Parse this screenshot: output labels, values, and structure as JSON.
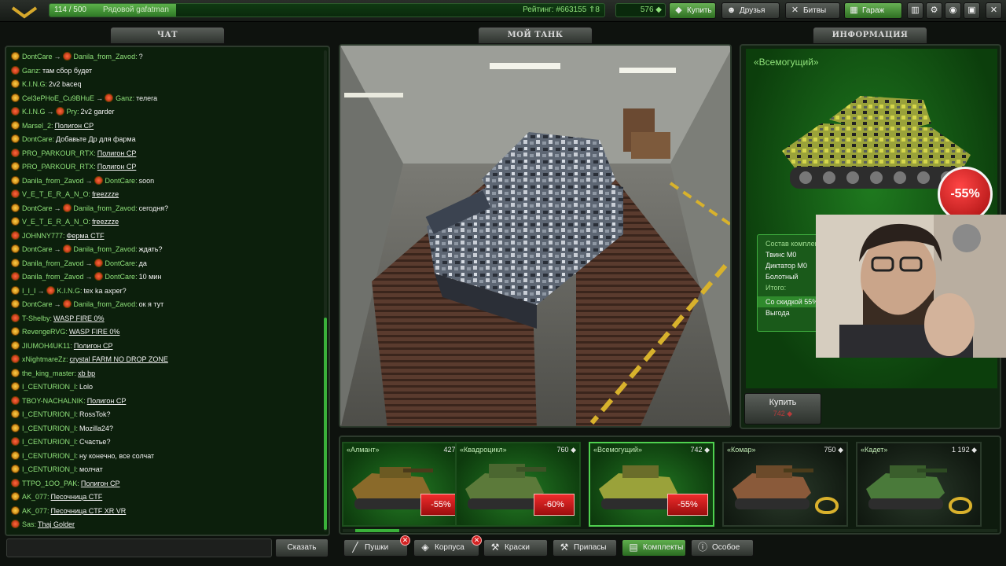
{
  "topbar": {
    "xp": "114 / 500",
    "xp_progress": 0.228,
    "rank_name": "Рядовой gafatman",
    "rating": "Рейтинг: #663155 ⇑8",
    "crystals": "576",
    "buy": "Купить",
    "friends": "Друзья",
    "battles": "Битвы",
    "garage": "Гараж"
  },
  "panels": {
    "chat": "ЧАТ",
    "my_tank": "МОЙ ТАНК",
    "info": "ИНФОРМАЦИЯ"
  },
  "chat": {
    "messages": [
      {
        "from": "DontCare",
        "to": "Danila_from_Zavod",
        "text": "?",
        "link": false
      },
      {
        "from": "Ganz",
        "to": "",
        "text": "там сбор будет",
        "link": false
      },
      {
        "from": "K.I.N.G",
        "to": "",
        "text": "2v2 baceq",
        "link": false
      },
      {
        "from": "Cel3ePHoE_Cu9BHuE",
        "to": "Ganz",
        "text": "телега",
        "link": false
      },
      {
        "from": "K.I.N.G",
        "to": "Pry",
        "text": "2v2 garder",
        "link": false
      },
      {
        "from": "Marsel_2",
        "to": "",
        "text": "Полигон CP",
        "link": true
      },
      {
        "from": "DontCare",
        "to": "",
        "text": "Добавьте Др для фарма",
        "link": false
      },
      {
        "from": "PRO_PARKOUR_RTX",
        "to": "",
        "text": "Полигон CP",
        "link": true
      },
      {
        "from": "PRO_PARKOUR_RTX",
        "to": "",
        "text": "Полигон CP",
        "link": true
      },
      {
        "from": "Danila_from_Zavod",
        "to": "DontCare",
        "text": "soon",
        "link": false
      },
      {
        "from": "V_E_T_E_R_A_N_O",
        "to": "",
        "text": "freezzze",
        "link": true
      },
      {
        "from": "DontCare",
        "to": "Danila_from_Zavod",
        "text": "сегодня?",
        "link": false
      },
      {
        "from": "V_E_T_E_R_A_N_O",
        "to": "",
        "text": "freezzze",
        "link": true
      },
      {
        "from": "JOHNNY777",
        "to": "",
        "text": "Ферма CTF",
        "link": true
      },
      {
        "from": "DontCare",
        "to": "Danila_from_Zavod",
        "text": "ждать?",
        "link": false
      },
      {
        "from": "Danila_from_Zavod",
        "to": "DontCare",
        "text": "да",
        "link": false
      },
      {
        "from": "Danila_from_Zavod",
        "to": "DontCare",
        "text": "10 мин",
        "link": false
      },
      {
        "from": "I_I_I",
        "to": "K.I.N.G",
        "text": "tex ka axper?",
        "link": false
      },
      {
        "from": "DontCare",
        "to": "Danila_from_Zavod",
        "text": "ок я тут",
        "link": false
      },
      {
        "from": "T-Shelby",
        "to": "",
        "text": "WASP FIRE 0%",
        "link": true
      },
      {
        "from": "RevengeRVG",
        "to": "",
        "text": "WASP FIRE 0%",
        "link": true
      },
      {
        "from": "JIUMOH4UK11",
        "to": "",
        "text": "Полигон CP",
        "link": true
      },
      {
        "from": "xNightmareZz",
        "to": "",
        "text": "crystal FARM NO DROP ZONE",
        "link": true
      },
      {
        "from": "the_king_master",
        "to": "",
        "text": "xb bp",
        "link": true
      },
      {
        "from": "I_CENTURION_I",
        "to": "",
        "text": "Lolo",
        "link": false
      },
      {
        "from": "TBOY-NACHALNIK",
        "to": "",
        "text": "Полигон CP",
        "link": true
      },
      {
        "from": "I_CENTURION_I",
        "to": "",
        "text": "RossTok?",
        "link": false
      },
      {
        "from": "I_CENTURION_I",
        "to": "",
        "text": "Mozilla24?",
        "link": false
      },
      {
        "from": "I_CENTURION_I",
        "to": "",
        "text": "Счастье?",
        "link": false
      },
      {
        "from": "I_CENTURION_I",
        "to": "",
        "text": "ну конечно, все солчат",
        "link": false
      },
      {
        "from": "I_CENTURION_I",
        "to": "",
        "text": "молчат",
        "link": false
      },
      {
        "from": "TTPO_1OO_PAK",
        "to": "",
        "text": "Полигон CP",
        "link": true
      },
      {
        "from": "AK_077",
        "to": "",
        "text": "Песочница CTF",
        "link": true
      },
      {
        "from": "AK_077",
        "to": "",
        "text": "Песочница CTF XR VR",
        "link": true
      },
      {
        "from": "Sas",
        "to": "",
        "text": "Thaj Golder",
        "link": true
      }
    ],
    "send": "Сказать"
  },
  "info": {
    "kit_title": "«Всемогущий»",
    "discount": "-55%",
    "composition_header": "Состав комплекта",
    "items": [
      "Твинс М0",
      "Диктатор М0",
      "Болотный"
    ],
    "total_label": "Итого:",
    "discount_label": "Со скидкой 55%",
    "profit_label": "Выгода",
    "buy_label": "Купить",
    "buy_price": "742 ◆"
  },
  "shop": {
    "cards": [
      {
        "name": "«Алмант»",
        "price": "427 ◆",
        "discount": "-55%"
      },
      {
        "name": "«Квадроцикл»",
        "price": "760 ◆",
        "discount": "-60%"
      },
      {
        "name": "«Всемогущий»",
        "price": "742 ◆",
        "discount": "-55%"
      },
      {
        "name": "«Комар»",
        "price": "750 ◆",
        "discount": ""
      },
      {
        "name": "«Кадет»",
        "price": "1 192 ◆",
        "discount": ""
      }
    ]
  },
  "bottom_tabs": {
    "guns": "Пушки",
    "hulls": "Корпуса",
    "paints": "Краски",
    "supplies": "Припасы",
    "kits": "Комплекты",
    "special": "Особое"
  },
  "colors": {
    "accent_green": "#3ab13a",
    "nick_green": "#8fe27a",
    "discount_red": "#d42323"
  }
}
